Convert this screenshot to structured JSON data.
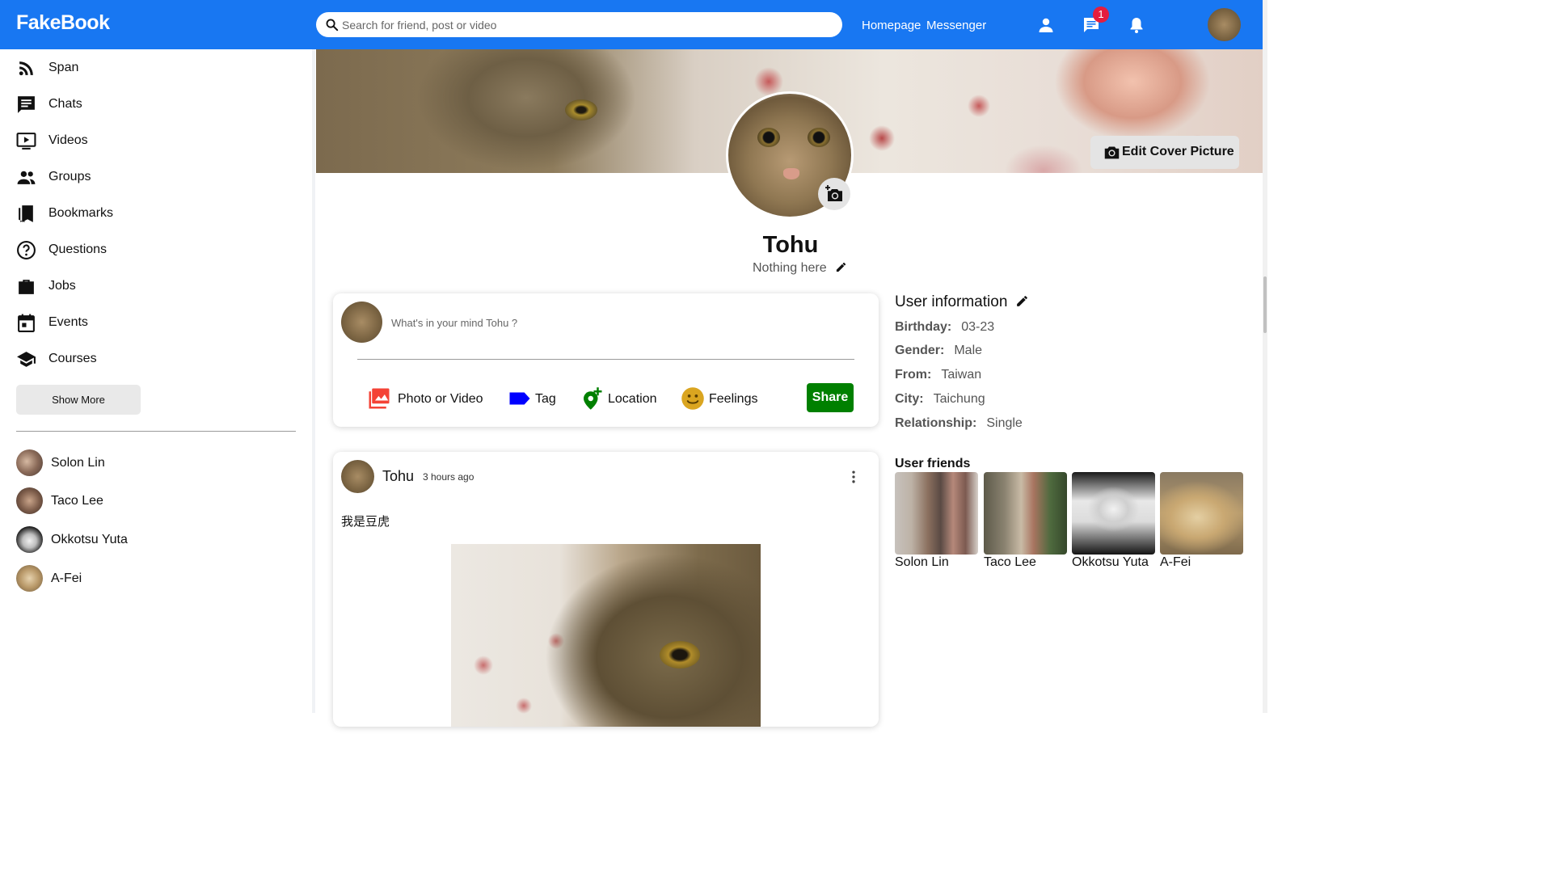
{
  "topbar": {
    "brand": "FakeBook",
    "search_placeholder": "Search for friend, post or video",
    "links": [
      "Homepage",
      "Messenger"
    ],
    "messages_badge": "1",
    "accent": "#1877f2"
  },
  "sidebar": {
    "items": [
      {
        "label": "Span",
        "icon": "rss-feed-icon"
      },
      {
        "label": "Chats",
        "icon": "chat-icon"
      },
      {
        "label": "Videos",
        "icon": "video-play-icon"
      },
      {
        "label": "Groups",
        "icon": "group-icon"
      },
      {
        "label": "Bookmarks",
        "icon": "bookmark-icon"
      },
      {
        "label": "Questions",
        "icon": "help-circle-icon"
      },
      {
        "label": "Jobs",
        "icon": "briefcase-icon"
      },
      {
        "label": "Events",
        "icon": "calendar-icon"
      },
      {
        "label": "Courses",
        "icon": "school-icon"
      }
    ],
    "show_more": "Show More",
    "friends": [
      "Solon Lin",
      "Taco Lee",
      "Okkotsu Yuta",
      "A-Fei"
    ]
  },
  "profile": {
    "name": "Tohu",
    "bio": "Nothing here",
    "edit_cover": "Edit Cover Picture"
  },
  "composer": {
    "placeholder": "What's in your mind Tohu ?",
    "actions": [
      {
        "label": "Photo or Video",
        "icon": "photo-library-icon",
        "color": "#f44336"
      },
      {
        "label": "Tag",
        "icon": "label-icon",
        "color": "#0000ff"
      },
      {
        "label": "Location",
        "icon": "add-location-icon",
        "color": "#008000"
      },
      {
        "label": "Feelings",
        "icon": "smiley-icon",
        "color": "#daa520"
      }
    ],
    "share": "Share",
    "share_color": "#008000"
  },
  "post": {
    "author": "Tohu",
    "time": "3 hours ago",
    "text": "我是豆虎"
  },
  "user_info": {
    "title": "User information",
    "rows": [
      {
        "key": "Birthday:",
        "value": "03-23"
      },
      {
        "key": "Gender:",
        "value": "Male"
      },
      {
        "key": "From:",
        "value": "Taiwan"
      },
      {
        "key": "City:",
        "value": "Taichung"
      },
      {
        "key": "Relationship:",
        "value": "Single"
      }
    ]
  },
  "user_friends": {
    "title": "User friends",
    "names": [
      "Solon Lin",
      "Taco Lee",
      "Okkotsu Yuta",
      "A-Fei"
    ]
  }
}
